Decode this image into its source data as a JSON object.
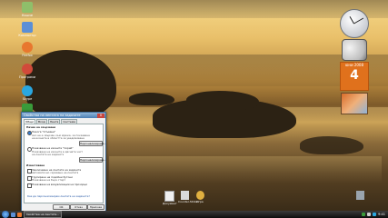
{
  "desktop": {
    "icons": [
      {
        "label": "Кошче",
        "color": "#8fbf6a"
      },
      {
        "label": "Компютър",
        "color": "#5b8fd6"
      },
      {
        "label": "Firefox",
        "color": "#e8772e"
      },
      {
        "label": "Програми",
        "color": "#d14a3a"
      },
      {
        "label": "Skype",
        "color": "#2aa7e0"
      },
      {
        "label": "Мрежа",
        "color": "#3a9b3a"
      }
    ],
    "bottom_icons": [
      {
        "label": "Документ",
        "color": "#f0f0f0"
      },
      {
        "label": "Counter-Strike",
        "color": "#d9d9d9"
      },
      {
        "label": "Игра",
        "color": "#e0b040"
      }
    ]
  },
  "gadgets": {
    "calendar_month": "юни 2008",
    "calendar_day": "4"
  },
  "dialog": {
    "title": "Свойства на лентата на задачите",
    "close": "X",
    "tabs": [
      "Общи",
      "Вход",
      "Лента",
      "Система"
    ],
    "section_connect": "Начин на свързване",
    "option_1": "Никога \"Сгъване\"",
    "option_1_desc": "Ако не е свързан към мрежа, за показване",
    "option_1_desc2": "на иконите в областта за уведомяване",
    "option_2": "Показване на иконите \"Скрий\"",
    "option_2_desc": "Показване на иконите в дясната част",
    "option_2_desc2": "на лентата на задачите",
    "button_1": "Персонализиране...",
    "button_2": "Персонализиране...",
    "section_notify": "Известяване",
    "check_1": "Заключване на лентата на задачите",
    "check_1_desc": "Автоматично скриване на лентата",
    "check_2": "Групиране на подобни бутони",
    "check_2_desc": "Показване на бърз старт",
    "check_3": "Показване на визуализации на прозорци",
    "link": "Как да персонализирам лентата на задачите?",
    "ok": "OK",
    "cancel": "Отказ",
    "apply": "Приложи"
  },
  "taskbar": {
    "start": "Start",
    "buttons": [
      "Свойства на лентата..."
    ],
    "clock": "9:41"
  }
}
